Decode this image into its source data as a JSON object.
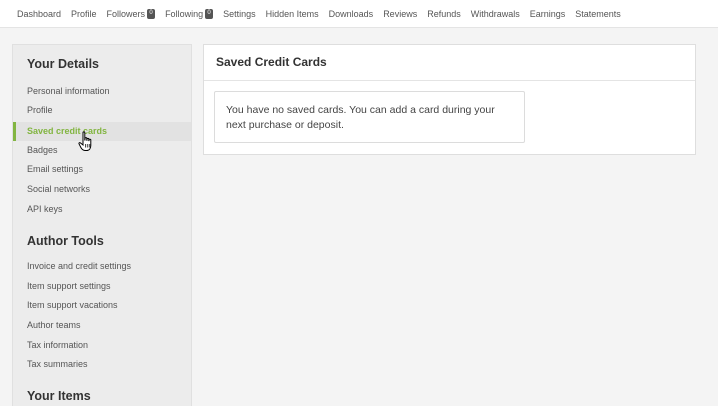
{
  "topnav": {
    "items": [
      {
        "label": "Dashboard"
      },
      {
        "label": "Profile"
      },
      {
        "label": "Followers",
        "badge": "0"
      },
      {
        "label": "Following",
        "badge": "0"
      },
      {
        "label": "Settings"
      },
      {
        "label": "Hidden Items"
      },
      {
        "label": "Downloads"
      },
      {
        "label": "Reviews"
      },
      {
        "label": "Refunds"
      },
      {
        "label": "Withdrawals"
      },
      {
        "label": "Earnings"
      },
      {
        "label": "Statements"
      }
    ]
  },
  "sidebar": {
    "your_details": {
      "title": "Your Details",
      "items": [
        "Personal information",
        "Profile",
        "Saved credit cards",
        "Badges",
        "Email settings",
        "Social networks",
        "API keys"
      ]
    },
    "author_tools": {
      "title": "Author Tools",
      "items": [
        "Invoice and credit settings",
        "Item support settings",
        "Item support vacations",
        "Author teams",
        "Tax information",
        "Tax summaries"
      ]
    },
    "your_items": {
      "title": "Your Items"
    },
    "active_item": "Saved credit cards",
    "accent_color": "#82b541"
  },
  "main": {
    "title": "Saved Credit Cards",
    "notice": "You have no saved cards. You can add a card during your next purchase or deposit."
  }
}
